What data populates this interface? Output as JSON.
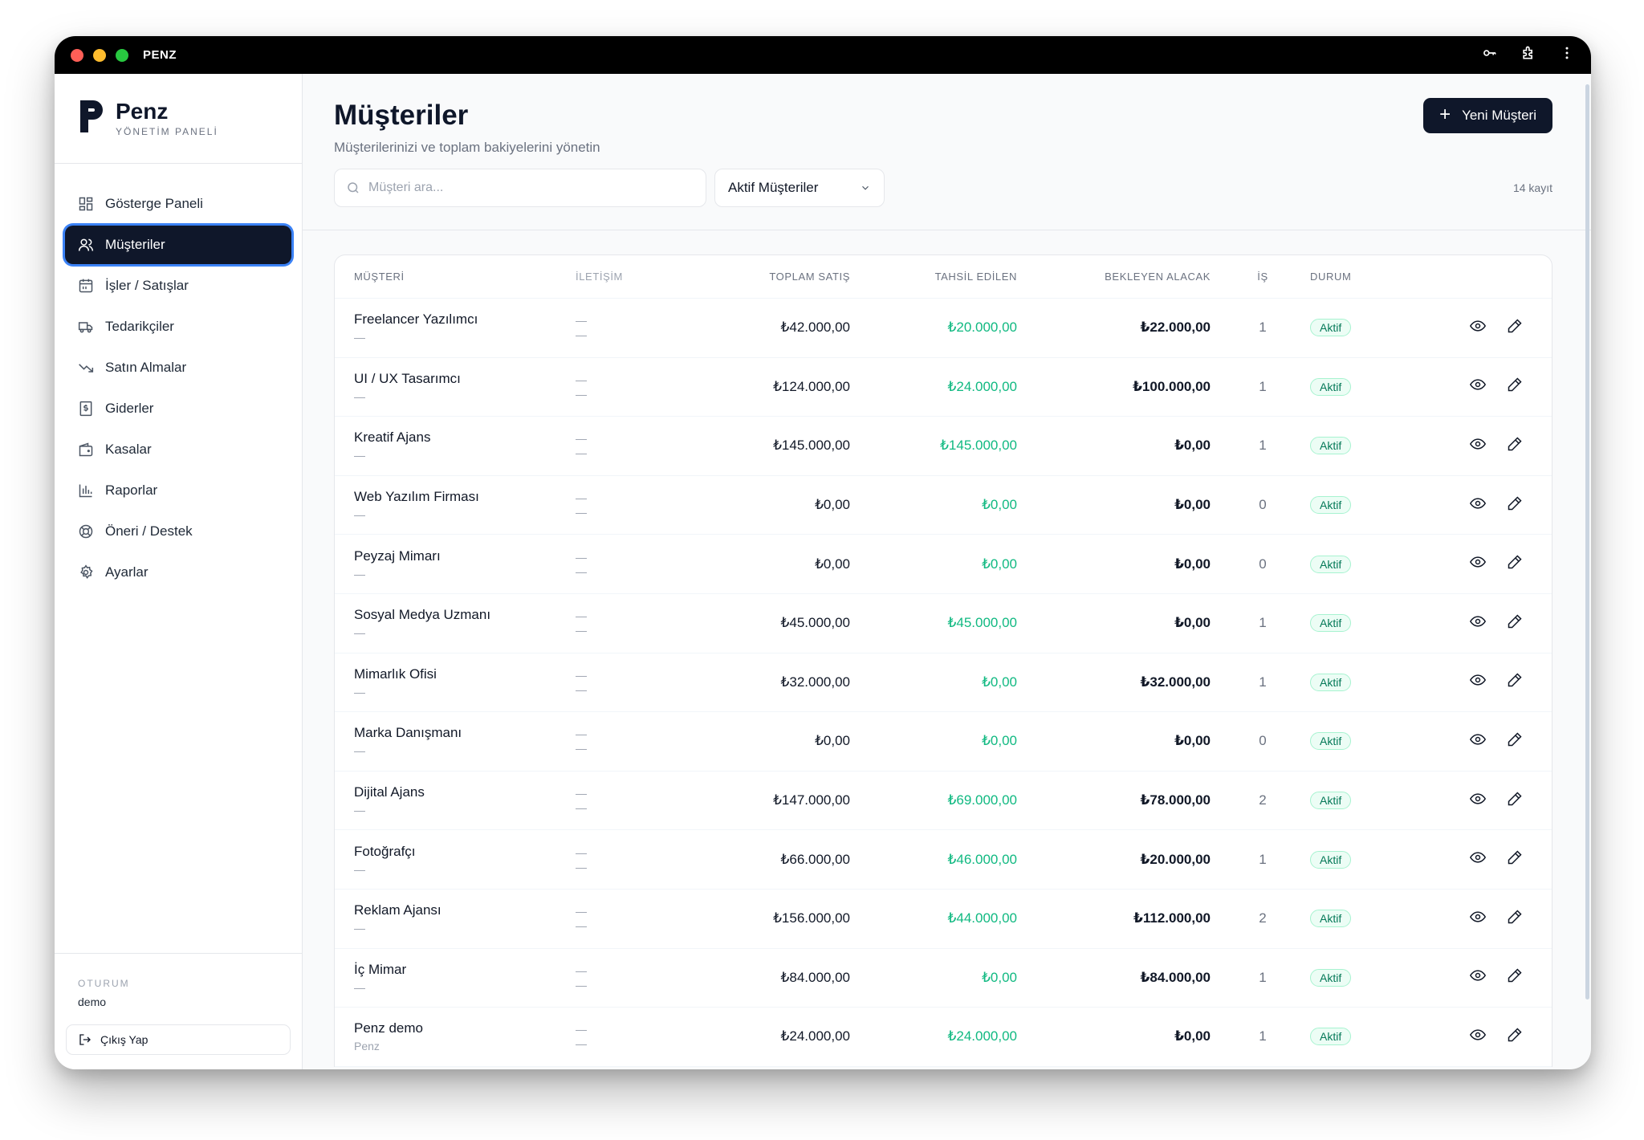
{
  "window": {
    "title": "PENZ",
    "colors": {
      "close": "#ff5f57",
      "minimize": "#febc2e",
      "maximize": "#28c840"
    }
  },
  "brand": {
    "name": "Penz",
    "subtitle": "YÖNETİM PANELİ"
  },
  "nav": {
    "items": [
      {
        "label": "Gösterge Paneli",
        "icon": "dashboard-icon"
      },
      {
        "label": "Müşteriler",
        "icon": "users-icon",
        "active": true
      },
      {
        "label": "İşler / Satışlar",
        "icon": "calendar-icon"
      },
      {
        "label": "Tedarikçiler",
        "icon": "truck-icon"
      },
      {
        "label": "Satın Almalar",
        "icon": "trending-down-icon"
      },
      {
        "label": "Giderler",
        "icon": "receipt-icon"
      },
      {
        "label": "Kasalar",
        "icon": "wallet-icon"
      },
      {
        "label": "Raporlar",
        "icon": "bar-chart-icon"
      },
      {
        "label": "Öneri / Destek",
        "icon": "lifebuoy-icon"
      },
      {
        "label": "Ayarlar",
        "icon": "settings-icon"
      }
    ]
  },
  "session": {
    "label": "OTURUM",
    "user": "demo",
    "logout_label": "Çıkış Yap"
  },
  "header": {
    "title": "Müşteriler",
    "subtitle": "Müşterilerinizi ve toplam bakiyelerini yönetin",
    "new_button": "Yeni Müşteri",
    "search_placeholder": "Müşteri ara...",
    "filter_value": "Aktif Müşteriler",
    "record_count": "14 kayıt"
  },
  "table": {
    "columns": [
      "MÜŞTERİ",
      "İLETİŞİM",
      "TOPLAM SATIŞ",
      "TAHSİL EDİLEN",
      "BEKLEYEN ALACAK",
      "İŞ",
      "DURUM"
    ],
    "rows": [
      {
        "name": "Freelancer Yazılımcı",
        "sub": "—",
        "c1": "—",
        "c2": "—",
        "sales": "₺42.000,00",
        "collected": "₺20.000,00",
        "pending": "₺22.000,00",
        "jobs": "1",
        "status": "Aktif"
      },
      {
        "name": "UI / UX Tasarımcı",
        "sub": "—",
        "c1": "—",
        "c2": "—",
        "sales": "₺124.000,00",
        "collected": "₺24.000,00",
        "pending": "₺100.000,00",
        "jobs": "1",
        "status": "Aktif"
      },
      {
        "name": "Kreatif Ajans",
        "sub": "—",
        "c1": "—",
        "c2": "—",
        "sales": "₺145.000,00",
        "collected": "₺145.000,00",
        "pending": "₺0,00",
        "jobs": "1",
        "status": "Aktif"
      },
      {
        "name": "Web Yazılım Firması",
        "sub": "—",
        "c1": "—",
        "c2": "—",
        "sales": "₺0,00",
        "collected": "₺0,00",
        "pending": "₺0,00",
        "jobs": "0",
        "status": "Aktif"
      },
      {
        "name": "Peyzaj Mimarı",
        "sub": "—",
        "c1": "—",
        "c2": "—",
        "sales": "₺0,00",
        "collected": "₺0,00",
        "pending": "₺0,00",
        "jobs": "0",
        "status": "Aktif"
      },
      {
        "name": "Sosyal Medya Uzmanı",
        "sub": "—",
        "c1": "—",
        "c2": "—",
        "sales": "₺45.000,00",
        "collected": "₺45.000,00",
        "pending": "₺0,00",
        "jobs": "1",
        "status": "Aktif"
      },
      {
        "name": "Mimarlık Ofisi",
        "sub": "—",
        "c1": "—",
        "c2": "—",
        "sales": "₺32.000,00",
        "collected": "₺0,00",
        "pending": "₺32.000,00",
        "jobs": "1",
        "status": "Aktif"
      },
      {
        "name": "Marka Danışmanı",
        "sub": "—",
        "c1": "—",
        "c2": "—",
        "sales": "₺0,00",
        "collected": "₺0,00",
        "pending": "₺0,00",
        "jobs": "0",
        "status": "Aktif"
      },
      {
        "name": "Dijital Ajans",
        "sub": "—",
        "c1": "—",
        "c2": "—",
        "sales": "₺147.000,00",
        "collected": "₺69.000,00",
        "pending": "₺78.000,00",
        "jobs": "2",
        "status": "Aktif"
      },
      {
        "name": "Fotoğrafçı",
        "sub": "—",
        "c1": "—",
        "c2": "—",
        "sales": "₺66.000,00",
        "collected": "₺46.000,00",
        "pending": "₺20.000,00",
        "jobs": "1",
        "status": "Aktif"
      },
      {
        "name": "Reklam Ajansı",
        "sub": "—",
        "c1": "—",
        "c2": "—",
        "sales": "₺156.000,00",
        "collected": "₺44.000,00",
        "pending": "₺112.000,00",
        "jobs": "2",
        "status": "Aktif"
      },
      {
        "name": "İç Mimar",
        "sub": "—",
        "c1": "—",
        "c2": "—",
        "sales": "₺84.000,00",
        "collected": "₺0,00",
        "pending": "₺84.000,00",
        "jobs": "1",
        "status": "Aktif"
      },
      {
        "name": "Penz demo",
        "sub": "Penz",
        "c1": "—",
        "c2": "—",
        "sales": "₺24.000,00",
        "collected": "₺24.000,00",
        "pending": "₺0,00",
        "jobs": "1",
        "status": "Aktif"
      }
    ]
  },
  "colors": {
    "primary": "#0f172a",
    "accent_green": "#10b981",
    "active_ring": "#3b82f6"
  }
}
